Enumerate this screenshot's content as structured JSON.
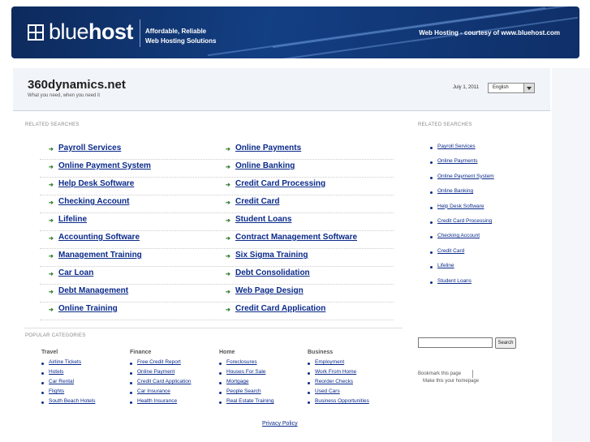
{
  "header": {
    "logo_light": "blue",
    "logo_bold": "host",
    "tagline_line1": "Affordable, Reliable",
    "tagline_line2": "Web Hosting Solutions",
    "courtesy": "Web Hosting - courtesy of www.bluehost.com"
  },
  "site": {
    "title": "360dynamics.net",
    "subtitle": "What you need, when you need it",
    "date": "July 1, 2011",
    "language": "English"
  },
  "related_label_left": "RELATED SEARCHES",
  "related_label_right": "RELATED SEARCHES",
  "main_links": [
    [
      "Payroll Services",
      "Online Payments"
    ],
    [
      "Online Payment System",
      "Online Banking"
    ],
    [
      "Help Desk Software",
      "Credit Card Processing"
    ],
    [
      "Checking Account",
      "Credit Card"
    ],
    [
      "Lifeline",
      "Student Loans"
    ],
    [
      "Accounting Software",
      "Contract Management Software"
    ],
    [
      "Management Training",
      "Six Sigma Training"
    ],
    [
      "Car Loan",
      "Debt Consolidation"
    ],
    [
      "Debt Management",
      "Web Page Design"
    ],
    [
      "Online Training",
      "Credit Card Application"
    ]
  ],
  "right_links": [
    "Payroll Services",
    "Online Payments",
    "Online Payment System",
    "Online Banking",
    "Help Desk Software",
    "Credit Card Processing",
    "Checking Account",
    "Credit Card",
    "Lifeline",
    "Student Loans"
  ],
  "popular_label": "POPULAR CATEGORIES",
  "categories": [
    {
      "title": "Travel",
      "items": [
        "Airline Tickets",
        "Hotels",
        "Car Rental",
        "Flights",
        "South Beach Hotels"
      ]
    },
    {
      "title": "Finance",
      "items": [
        "Free Credit Report",
        "Online Payment",
        "Credit Card Application",
        "Car Insurance",
        "Health Insurance"
      ]
    },
    {
      "title": "Home",
      "items": [
        "Foreclosures",
        "Houses For Sale",
        "Mortgage",
        "People Search",
        "Real Estate Training"
      ]
    },
    {
      "title": "Business",
      "items": [
        "Employment",
        "Work From Home",
        "Reorder Checks",
        "Used Cars",
        "Business Opportunities"
      ]
    }
  ],
  "search": {
    "button": "Search"
  },
  "bookmark": "Bookmark this page",
  "homepage": "Make this your homepage",
  "privacy": "Privacy Policy"
}
